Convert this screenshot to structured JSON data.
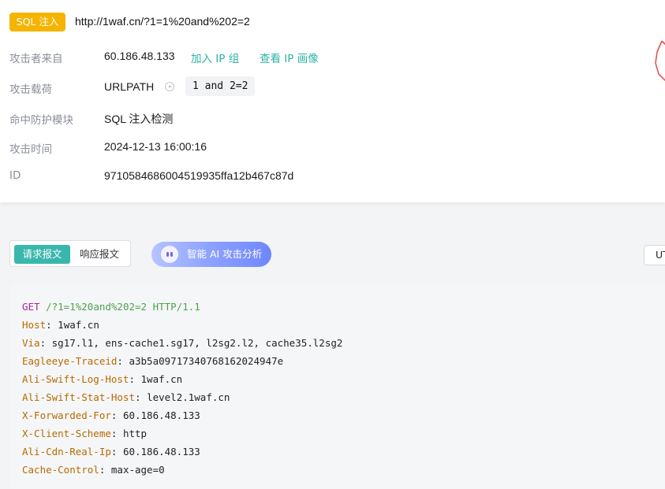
{
  "header": {
    "badge": "SQL 注入",
    "url": "http://1waf.cn/?1=1%20and%202=2"
  },
  "details": {
    "source_label": "攻击者来自",
    "source_ip": "60.186.48.133",
    "add_ip_group": "加入 IP 组",
    "view_ip_profile": "查看 IP 画像",
    "payload_label": "攻击载荷",
    "payload_location": "URLPATH",
    "payload_value": "1 and 2=2",
    "module_label": "命中防护模块",
    "module_value": "SQL 注入检测",
    "time_label": "攻击时间",
    "time_value": "2024-12-13 16:00:16",
    "id_label": "ID",
    "id_value": "971058468600451993​5ffa12b467c87d"
  },
  "tabs": {
    "request": "请求报文",
    "response": "响应报文",
    "ai_analysis": "智能 AI 攻击分析",
    "encoding": "UT"
  },
  "request": {
    "method": "GET",
    "path": "/?1=1%20and%202=2",
    "protocol": "HTTP/1.1",
    "headers": [
      {
        "key": "Host",
        "value": "1waf.cn"
      },
      {
        "key": "Via",
        "value": "sg17.l1, ens-cache1.sg17, l2sg2.l2, cache35.l2sg2"
      },
      {
        "key": "Eagleeye-Traceid",
        "value": "a3b5a09717340768162024947e"
      },
      {
        "key": "Ali-Swift-Log-Host",
        "value": "1waf.cn"
      },
      {
        "key": "Ali-Swift-Stat-Host",
        "value": "level2.1waf.cn"
      },
      {
        "key": "X-Forwarded-For",
        "value": "60.186.48.133"
      },
      {
        "key": "X-Client-Scheme",
        "value": "http"
      },
      {
        "key": "Ali-Cdn-Real-Ip",
        "value": "60.186.48.133"
      },
      {
        "key": "Cache-Control",
        "value": "max-age=0"
      }
    ]
  },
  "colors": {
    "badge": "#f5b400",
    "link": "#2db3a7",
    "active_tab": "#3ab7ad"
  }
}
